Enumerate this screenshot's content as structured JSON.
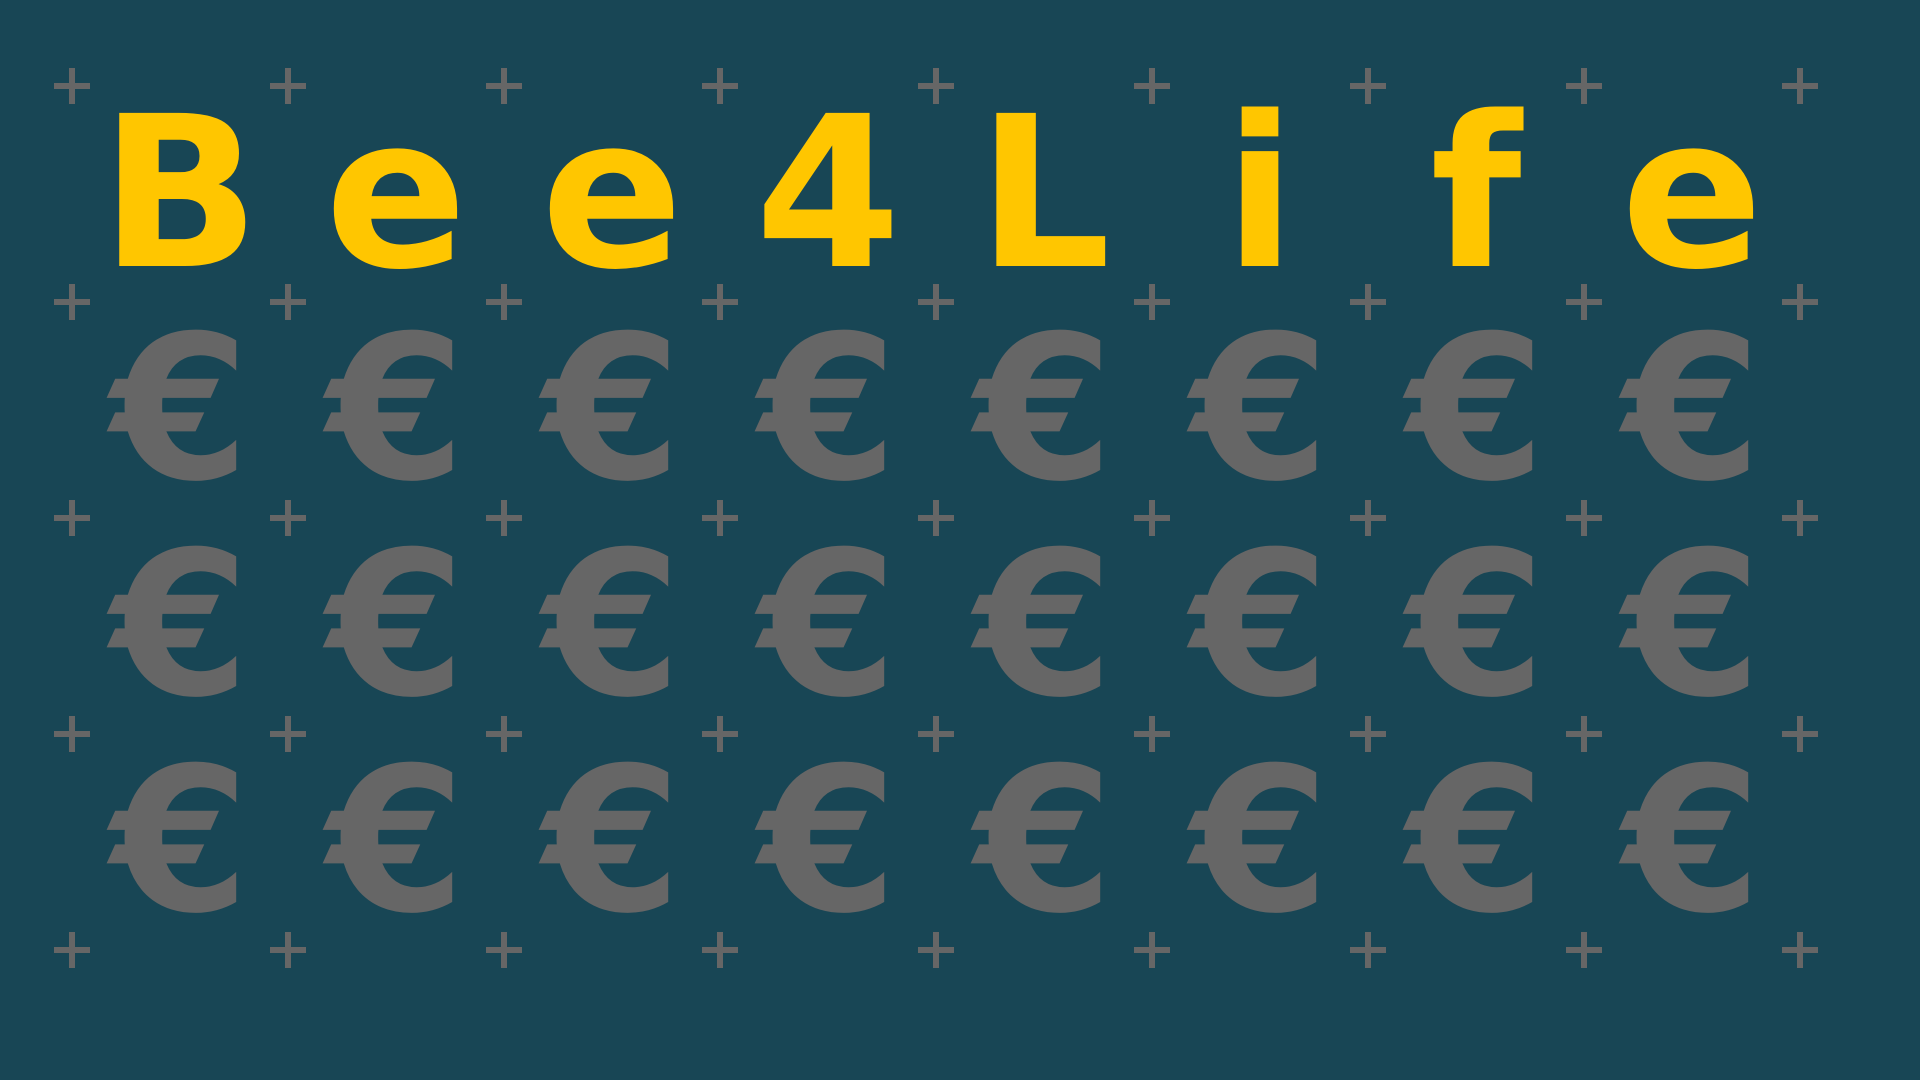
{
  "colors": {
    "background": "#184655",
    "title": "#FFC600",
    "euro": "#666666",
    "plus": "#666666"
  },
  "title": {
    "letters": [
      "B",
      "e",
      "e",
      "4",
      "L",
      "i",
      "f",
      "e"
    ]
  },
  "euro_grid": {
    "symbol": "€",
    "rows": [
      [
        "€",
        "€",
        "€",
        "€",
        "€",
        "€",
        "€",
        "€"
      ],
      [
        "€",
        "€",
        "€",
        "€",
        "€",
        "€",
        "€",
        "€"
      ],
      [
        "€",
        "€",
        "€",
        "€",
        "€",
        "€",
        "€",
        "€"
      ]
    ]
  },
  "icons": {
    "cross": "plus-icon"
  }
}
